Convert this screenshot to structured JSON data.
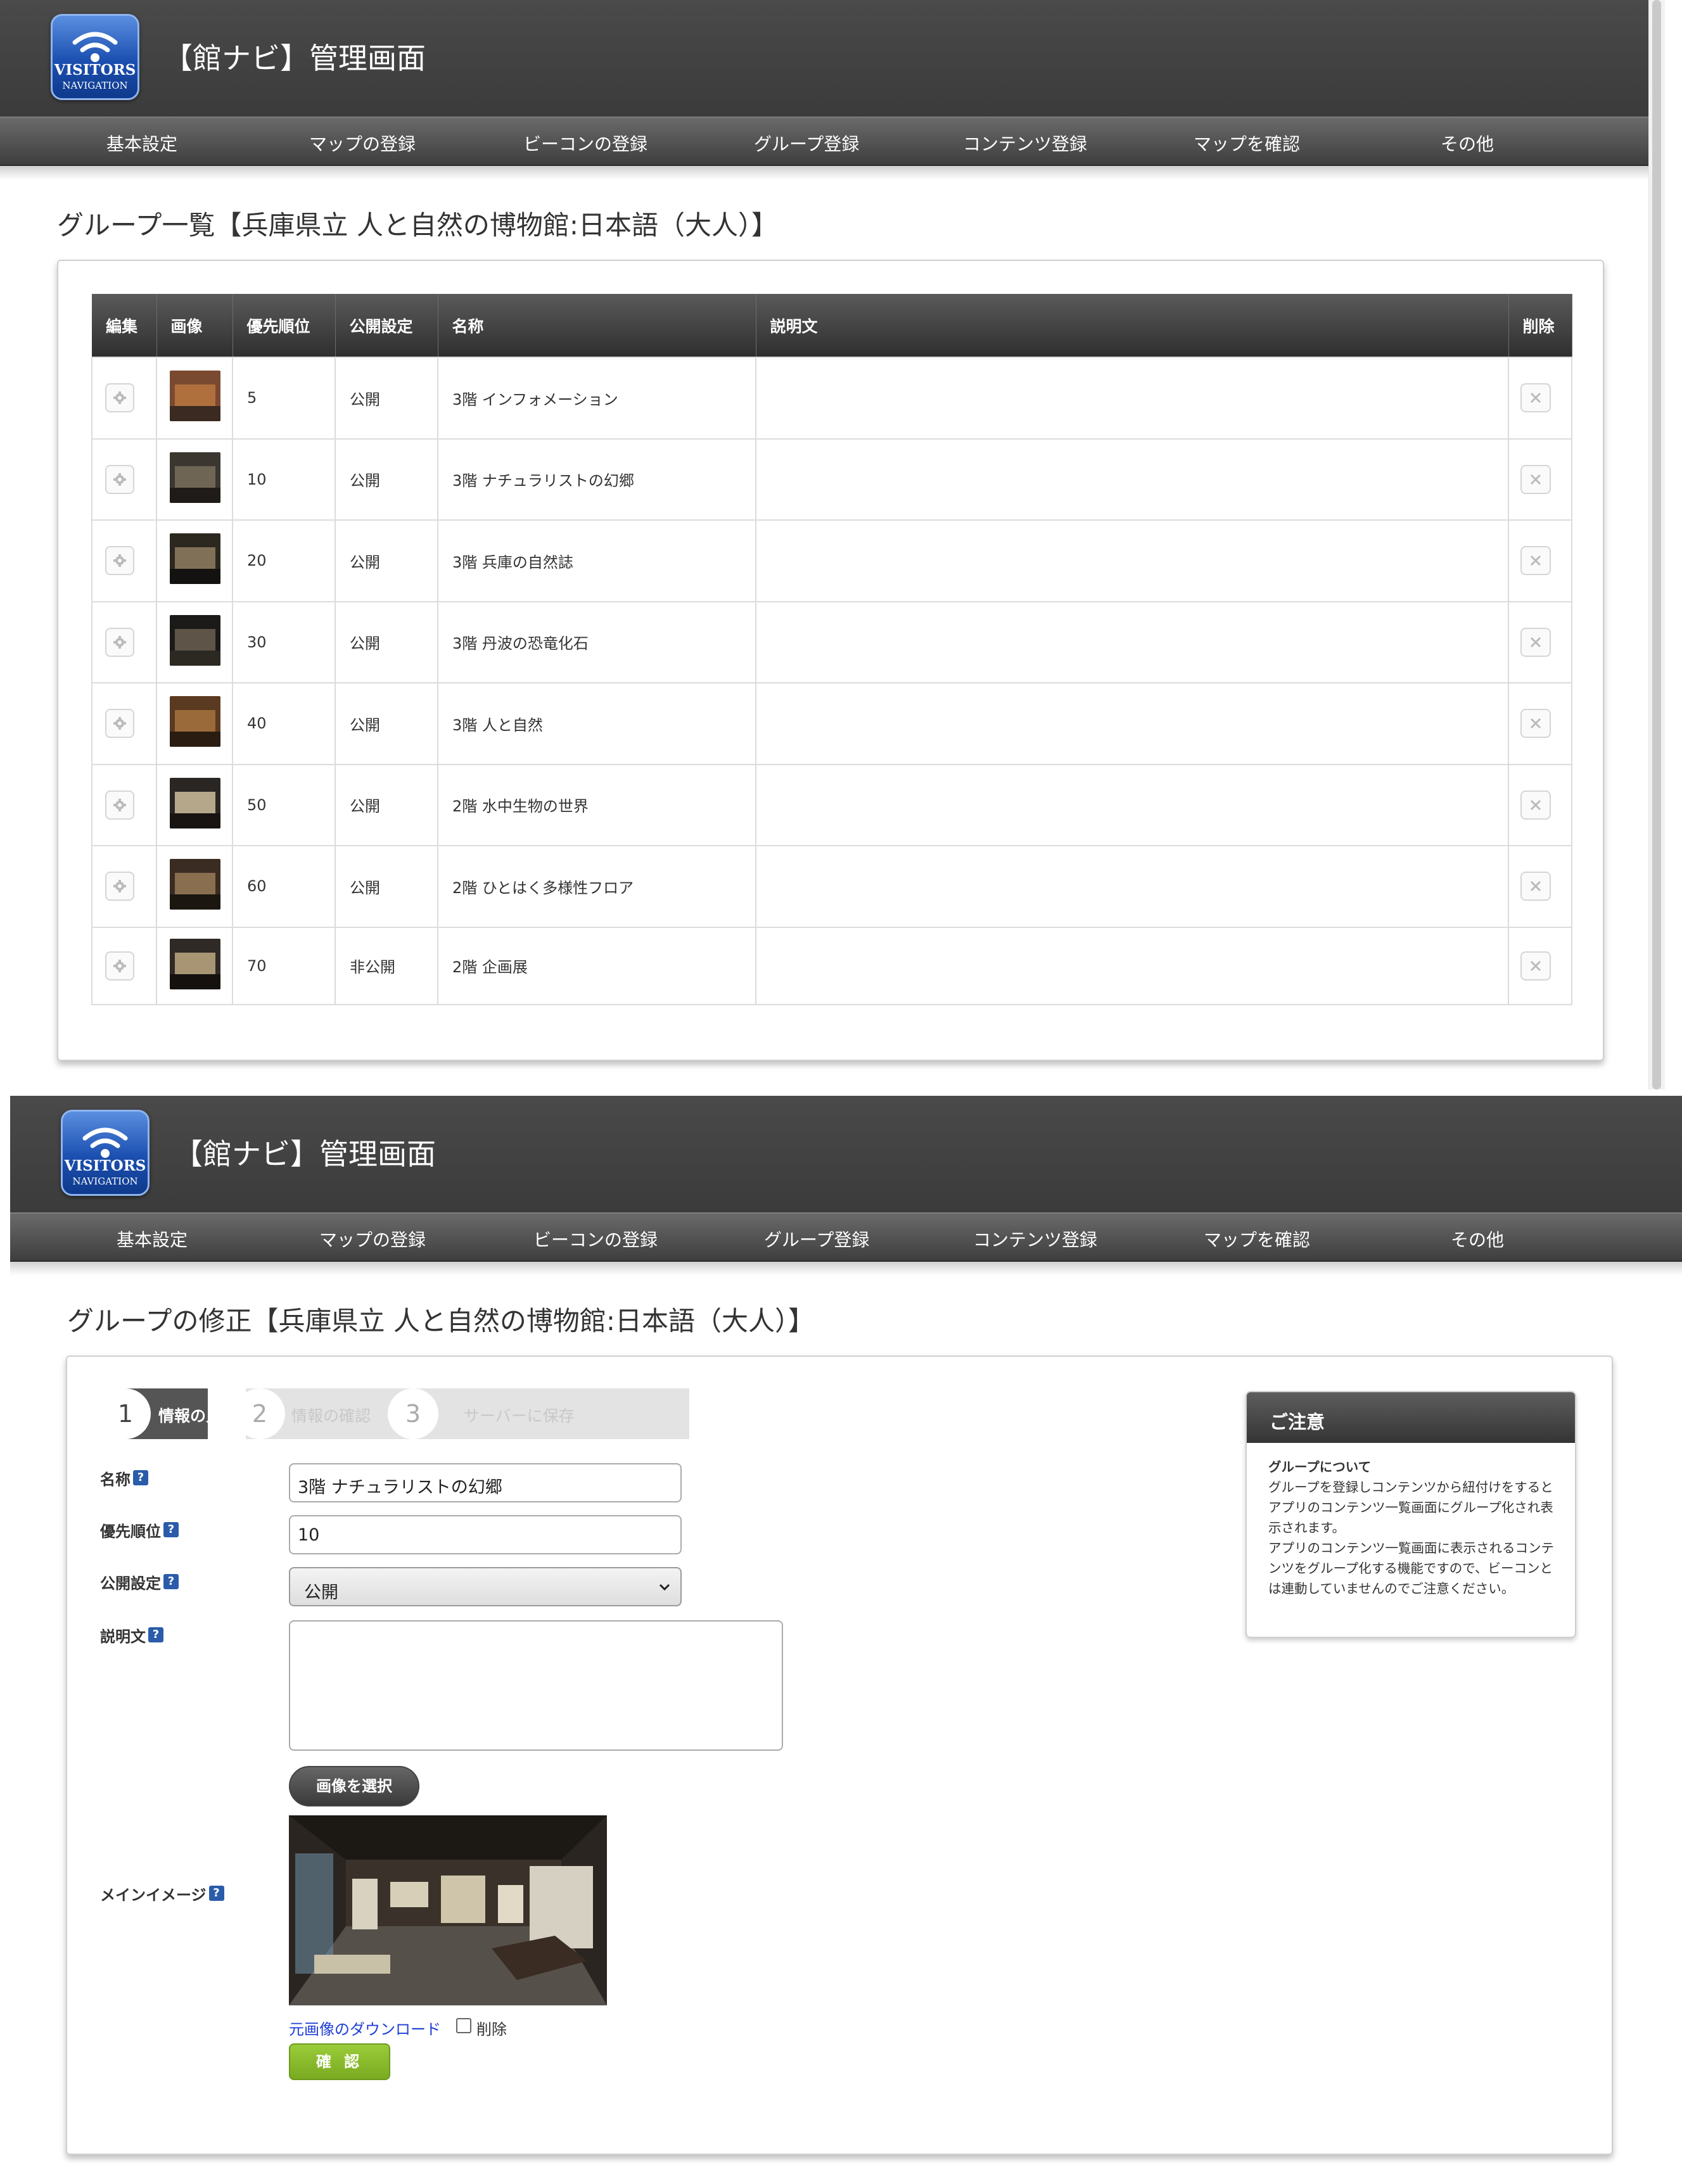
{
  "app": {
    "title": "【館ナビ】管理画面",
    "logo_line1": "VISITORS",
    "logo_line2": "NAVIGATION"
  },
  "nav": [
    {
      "label": "基本設定"
    },
    {
      "label": "マップの登録"
    },
    {
      "label": "ビーコンの登録"
    },
    {
      "label": "グループ登録"
    },
    {
      "label": "コンテンツ登録"
    },
    {
      "label": "マップを確認"
    },
    {
      "label": "その他"
    }
  ],
  "list_page": {
    "title": "グループ一覧【兵庫県立 人と自然の博物館:日本語（大人）】",
    "columns": [
      "編集",
      "画像",
      "優先順位",
      "公開設定",
      "名称",
      "説明文",
      "削除"
    ],
    "rows": [
      {
        "priority": "5",
        "status": "公開",
        "name": "3階 インフォメーション",
        "desc": ""
      },
      {
        "priority": "10",
        "status": "公開",
        "name": "3階 ナチュラリストの幻郷",
        "desc": ""
      },
      {
        "priority": "20",
        "status": "公開",
        "name": "3階 兵庫の自然誌",
        "desc": ""
      },
      {
        "priority": "30",
        "status": "公開",
        "name": "3階 丹波の恐竜化石",
        "desc": ""
      },
      {
        "priority": "40",
        "status": "公開",
        "name": "3階 人と自然",
        "desc": ""
      },
      {
        "priority": "50",
        "status": "公開",
        "name": "2階 水中生物の世界",
        "desc": ""
      },
      {
        "priority": "60",
        "status": "公開",
        "name": "2階 ひとはく多様性フロア",
        "desc": ""
      },
      {
        "priority": "70",
        "status": "非公開",
        "name": "2階 企画展",
        "desc": ""
      }
    ]
  },
  "edit_page": {
    "title": "グループの修正【兵庫県立 人と自然の博物館:日本語（大人）】",
    "steps": [
      {
        "num": "1",
        "label": "情報の入力"
      },
      {
        "num": "2",
        "label": "情報の確認"
      },
      {
        "num": "3",
        "label": "サーバーに保存"
      }
    ],
    "fields": {
      "name_label": "名称",
      "name_value": "3階 ナチュラリストの幻郷",
      "priority_label": "優先順位",
      "priority_value": "10",
      "status_label": "公開設定",
      "status_value": "公開",
      "desc_label": "説明文",
      "desc_value": "",
      "image_label": "メインイメージ"
    },
    "help_glyph": "?",
    "select_image_button": "画像を選択",
    "download_link": "元画像のダウンロード",
    "delete_checkbox_label": "削除",
    "confirm_button": "確 認",
    "notice": {
      "title": "ご注意",
      "subtitle": "グループについて",
      "body1": "グループを登録しコンテンツから紐付けをするとアプリのコンテンツ一覧画面にグループ化され表示されます。",
      "body2": "アプリのコンテンツ一覧画面に表示されるコンテンツをグループ化する機能ですので、ビーコンとは連動していませんのでご注意ください。"
    }
  },
  "icons": {
    "logo": "wifi-icon",
    "edit": "gear-icon",
    "delete": "close-icon",
    "select": "chevron-down-icon",
    "help": "help-icon"
  },
  "colors": {
    "header_bg": "#3e3e3e",
    "nav_bg": "#555555",
    "accent_green": "#8bbd2e",
    "link_blue": "#1f3ed6",
    "help_blue": "#2a5caa"
  }
}
